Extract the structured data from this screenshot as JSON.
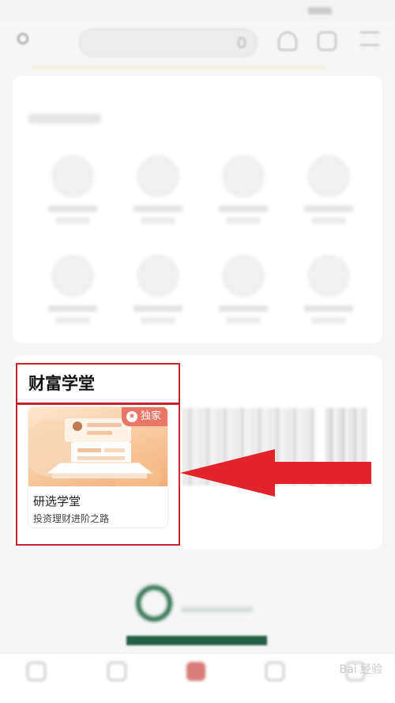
{
  "wealth_school": {
    "title": "财富学堂",
    "course": {
      "badge": "独家",
      "title": "研选学堂",
      "subtitle": "投资理财进阶之路"
    }
  },
  "colors": {
    "highlight_border": "#c8232c",
    "arrow": "#e3232b",
    "badge": "#e87566",
    "brand_green": "#236045"
  },
  "watermark": "Bai 经验"
}
